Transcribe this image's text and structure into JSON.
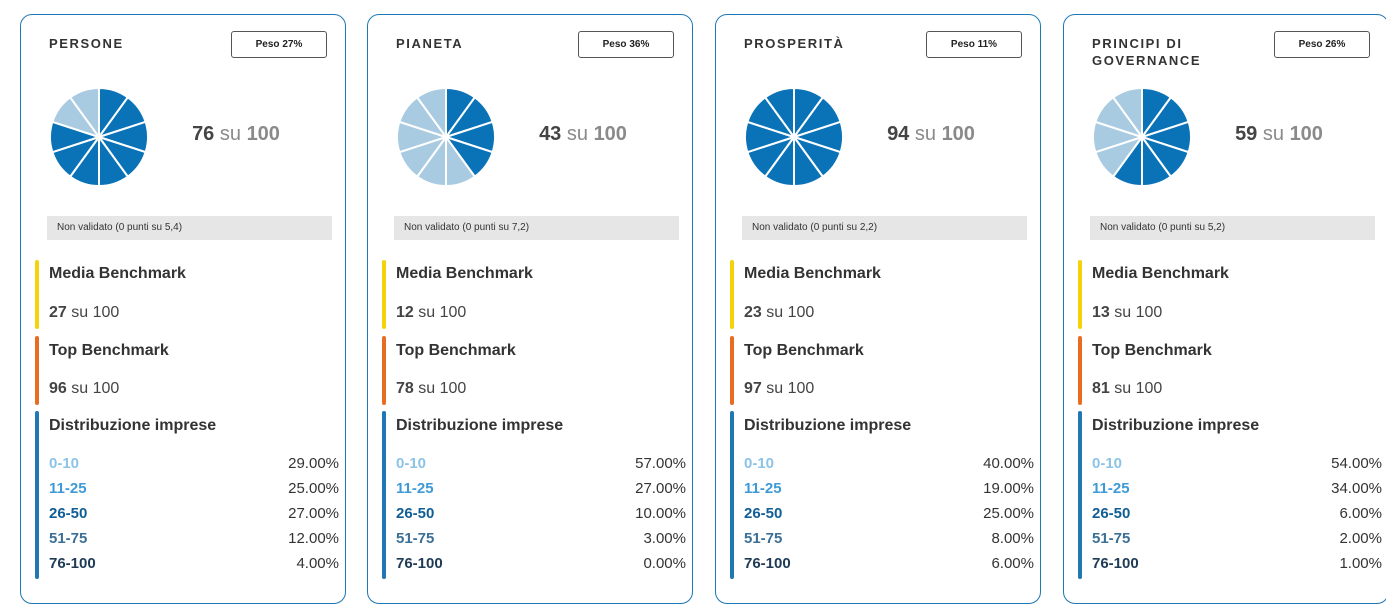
{
  "colors": {
    "border": "#1f77b4",
    "slice_filled": "#0a73b8",
    "slice_empty": "#a9cbe2",
    "media_bar": "#f5d20a",
    "top_bar": "#e86d22",
    "dist_bar": "#1f77b4",
    "range_colors": [
      "#8cc3e6",
      "#3d9ad6",
      "#0f5e96",
      "#3b6f95",
      "#1e3a55"
    ]
  },
  "cards": [
    {
      "title": "PERSONE",
      "weight": "Peso 27%",
      "score": "76",
      "score_sep": "su",
      "score_max": "100",
      "pie_filled_slices": 8,
      "pie_total_slices": 10,
      "validation": "Non validato (0 punti su 5,4)",
      "media": {
        "title": "Media Benchmark",
        "value": "27",
        "suffix": "su 100"
      },
      "top": {
        "title": "Top Benchmark",
        "value": "96",
        "suffix": "su 100"
      },
      "dist_title": "Distribuzione imprese",
      "dist": [
        {
          "range": "0-10",
          "pct": "29.00%"
        },
        {
          "range": "11-25",
          "pct": "25.00%"
        },
        {
          "range": "26-50",
          "pct": "27.00%"
        },
        {
          "range": "51-75",
          "pct": "12.00%"
        },
        {
          "range": "76-100",
          "pct": "4.00%"
        }
      ]
    },
    {
      "title": "PIANETA",
      "weight": "Peso 36%",
      "score": "43",
      "score_sep": "su",
      "score_max": "100",
      "pie_filled_slices": 4,
      "pie_total_slices": 10,
      "validation": "Non validato (0 punti su 7,2)",
      "media": {
        "title": "Media Benchmark",
        "value": "12",
        "suffix": "su 100"
      },
      "top": {
        "title": "Top Benchmark",
        "value": "78",
        "suffix": "su 100"
      },
      "dist_title": "Distribuzione imprese",
      "dist": [
        {
          "range": "0-10",
          "pct": "57.00%"
        },
        {
          "range": "11-25",
          "pct": "27.00%"
        },
        {
          "range": "26-50",
          "pct": "10.00%"
        },
        {
          "range": "51-75",
          "pct": "3.00%"
        },
        {
          "range": "76-100",
          "pct": "0.00%"
        }
      ]
    },
    {
      "title": "PROSPERITÀ",
      "weight": "Peso 11%",
      "score": "94",
      "score_sep": "su",
      "score_max": "100",
      "pie_filled_slices": 10,
      "pie_total_slices": 10,
      "validation": "Non validato (0 punti su 2,2)",
      "media": {
        "title": "Media Benchmark",
        "value": "23",
        "suffix": "su 100"
      },
      "top": {
        "title": "Top Benchmark",
        "value": "97",
        "suffix": "su 100"
      },
      "dist_title": "Distribuzione imprese",
      "dist": [
        {
          "range": "0-10",
          "pct": "40.00%"
        },
        {
          "range": "11-25",
          "pct": "19.00%"
        },
        {
          "range": "26-50",
          "pct": "25.00%"
        },
        {
          "range": "51-75",
          "pct": "8.00%"
        },
        {
          "range": "76-100",
          "pct": "6.00%"
        }
      ]
    },
    {
      "title": "PRINCIPI DI GOVERNANCE",
      "weight": "Peso 26%",
      "score": "59",
      "score_sep": "su",
      "score_max": "100",
      "pie_filled_slices": 6,
      "pie_total_slices": 10,
      "validation": "Non validato (0 punti su 5,2)",
      "media": {
        "title": "Media Benchmark",
        "value": "13",
        "suffix": "su 100"
      },
      "top": {
        "title": "Top Benchmark",
        "value": "81",
        "suffix": "su 100"
      },
      "dist_title": "Distribuzione imprese",
      "dist": [
        {
          "range": "0-10",
          "pct": "54.00%"
        },
        {
          "range": "11-25",
          "pct": "34.00%"
        },
        {
          "range": "26-50",
          "pct": "6.00%"
        },
        {
          "range": "51-75",
          "pct": "2.00%"
        },
        {
          "range": "76-100",
          "pct": "1.00%"
        }
      ]
    }
  ]
}
